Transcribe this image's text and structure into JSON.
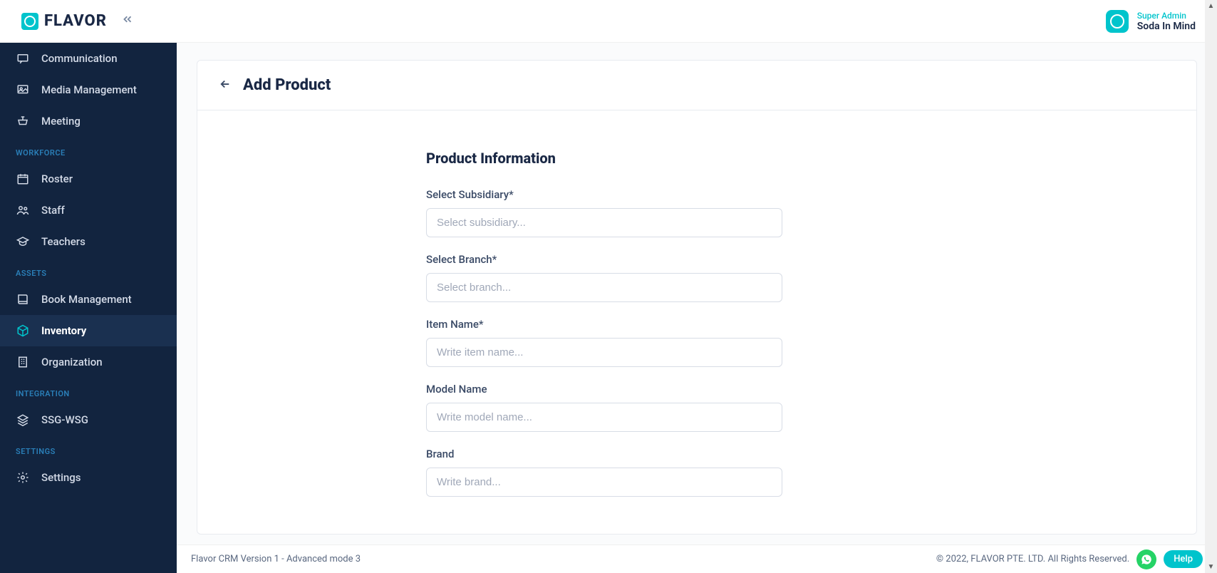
{
  "brand": "FLAVOR",
  "user": {
    "role": "Super Admin",
    "company": "Soda In Mind"
  },
  "sidebar": {
    "items": [
      {
        "label": "Communication",
        "icon": "message"
      },
      {
        "label": "Media Management",
        "icon": "media"
      },
      {
        "label": "Meeting",
        "icon": "podium"
      }
    ],
    "sections": [
      {
        "title": "WORKFORCE",
        "items": [
          {
            "label": "Roster",
            "icon": "calendar"
          },
          {
            "label": "Staff",
            "icon": "people"
          },
          {
            "label": "Teachers",
            "icon": "graduation"
          }
        ]
      },
      {
        "title": "ASSETS",
        "items": [
          {
            "label": "Book Management",
            "icon": "book"
          },
          {
            "label": "Inventory",
            "icon": "package",
            "active": true
          },
          {
            "label": "Organization",
            "icon": "building"
          }
        ]
      },
      {
        "title": "INTEGRATION",
        "items": [
          {
            "label": "SSG-WSG",
            "icon": "layers"
          }
        ]
      },
      {
        "title": "SETTINGS",
        "items": [
          {
            "label": "Settings",
            "icon": "gear"
          }
        ]
      }
    ]
  },
  "page": {
    "title": "Add Product",
    "section_title": "Product Information",
    "fields": {
      "subsidiary": {
        "label": "Select Subsidiary*",
        "placeholder": "Select subsidiary..."
      },
      "branch": {
        "label": "Select Branch*",
        "placeholder": "Select branch..."
      },
      "item": {
        "label": "Item Name*",
        "placeholder": "Write item name..."
      },
      "model": {
        "label": "Model Name",
        "placeholder": "Write model name..."
      },
      "brand": {
        "label": "Brand",
        "placeholder": "Write brand..."
      }
    }
  },
  "footer": {
    "version": "Flavor CRM Version 1 - Advanced mode 3",
    "copyright": "© 2022, FLAVOR PTE. LTD. All Rights Reserved.",
    "help": "Help"
  }
}
